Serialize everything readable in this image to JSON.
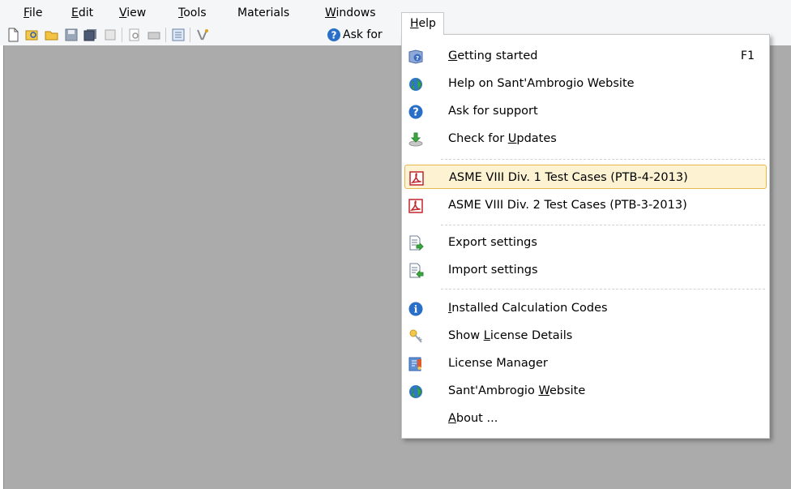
{
  "menubar": {
    "items": [
      {
        "label": "File",
        "accel": "F",
        "rest": "ile"
      },
      {
        "label": "Edit",
        "accel": "E",
        "rest": "dit"
      },
      {
        "label": "View",
        "accel": "V",
        "rest": "iew"
      },
      {
        "label": "Tools",
        "accel": "T",
        "rest": "ools"
      },
      {
        "label": "Materials"
      },
      {
        "label": "Windows",
        "accel": "W",
        "rest": "indows"
      },
      {
        "label": "Help",
        "accel": "H",
        "rest": "elp"
      }
    ]
  },
  "toolbar": {
    "ask_for": "Ask for"
  },
  "help_menu": {
    "items": [
      {
        "pre": "",
        "accel": "G",
        "post": "etting started",
        "shortcut": "F1",
        "icon": "help-book-icon"
      },
      {
        "pre": "Help on Sant'Ambrogio Website",
        "accel": "",
        "post": "",
        "icon": "globe-icon"
      },
      {
        "pre": "Ask for support",
        "accel": "",
        "post": "",
        "icon": "question-icon"
      },
      {
        "pre": "Check for ",
        "accel": "U",
        "post": "pdates",
        "icon": "download-icon"
      },
      {
        "pre": "ASME VIII Div. 1 Test Cases (PTB-4-2013)",
        "accel": "",
        "post": "",
        "icon": "pdf-icon",
        "highlighted": true
      },
      {
        "pre": "ASME VIII Div. 2 Test Cases (PTB-3-2013)",
        "accel": "",
        "post": "",
        "icon": "pdf-icon"
      },
      {
        "pre": "Export settings",
        "accel": "",
        "post": "",
        "icon": "export-icon"
      },
      {
        "pre": "Import settings",
        "accel": "",
        "post": "",
        "icon": "import-icon"
      },
      {
        "pre": "",
        "accel": "I",
        "post": "nstalled Calculation Codes",
        "icon": "info-icon"
      },
      {
        "pre": "Show ",
        "accel": "L",
        "post": "icense Details",
        "icon": "key-icon"
      },
      {
        "pre": "License Manager",
        "accel": "",
        "post": "",
        "icon": "license-manager-icon"
      },
      {
        "pre": "Sant'Ambrogio ",
        "accel": "W",
        "post": "ebsite",
        "icon": "globe-icon"
      },
      {
        "pre": "",
        "accel": "A",
        "post": "bout ...",
        "icon": ""
      }
    ]
  },
  "colors": {
    "highlight": "#fdf3d3",
    "highlight_border": "#e6b84c",
    "workspace": "#ababab",
    "menubar": "#f5f6f7"
  }
}
